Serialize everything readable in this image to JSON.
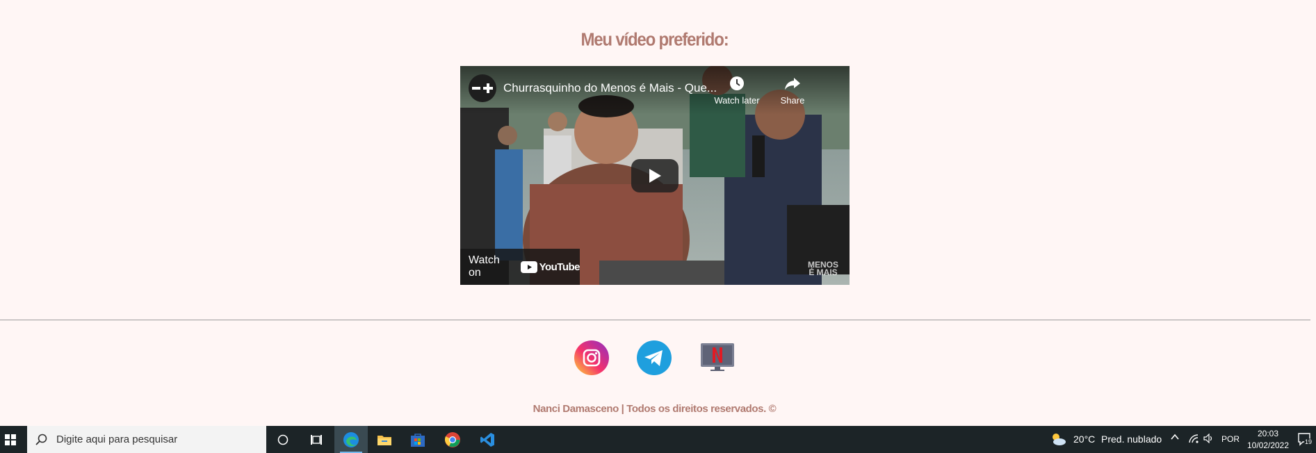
{
  "page": {
    "heading": "Meu vídeo preferido:",
    "footer_text": "Nanci Damasceno | Todos os direitos reservados. ©",
    "colors": {
      "background": "#fff6f5",
      "accent": "#b07a70",
      "divider": "#9b9b9b"
    }
  },
  "video": {
    "title": "Churrasquinho do Menos é Mais - Que...",
    "watch_later_label": "Watch later",
    "share_label": "Share",
    "watch_on_label": "Watch on",
    "youtube_wordmark": "YouTube",
    "channel_watermark": "MENOS É MAIS",
    "play_icon": "play-icon"
  },
  "social_links": [
    {
      "name": "instagram",
      "icon": "instagram-icon"
    },
    {
      "name": "telegram",
      "icon": "telegram-icon"
    },
    {
      "name": "netflix",
      "icon": "netflix-icon"
    }
  ],
  "taskbar": {
    "search_placeholder": "Digite aqui para pesquisar",
    "apps": [
      "cortana-icon",
      "task-view-icon",
      "edge-icon",
      "file-explorer-icon",
      "store-icon",
      "chrome-icon",
      "vscode-icon"
    ],
    "weather_temp": "20°C",
    "weather_desc": "Pred. nublado",
    "language": "POR",
    "time": "20:03",
    "date": "10/02/2022",
    "notification_count": "19"
  }
}
